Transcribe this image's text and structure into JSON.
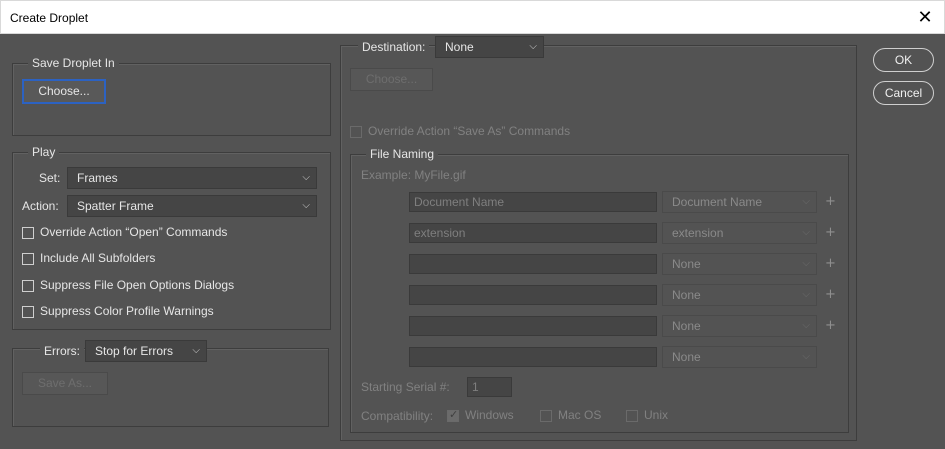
{
  "window": {
    "title": "Create Droplet",
    "close_glyph": "✕"
  },
  "save_in": {
    "legend": "Save Droplet In",
    "choose_label": "Choose..."
  },
  "play": {
    "legend": "Play",
    "set_label": "Set:",
    "set_value": "Frames",
    "action_label": "Action:",
    "action_value": "Spatter Frame",
    "options": [
      "Override Action “Open” Commands",
      "Include All Subfolders",
      "Suppress File Open Options Dialogs",
      "Suppress Color Profile Warnings"
    ]
  },
  "errors": {
    "label": "Errors:",
    "value": "Stop for Errors",
    "save_as_label": "Save As..."
  },
  "destination": {
    "label": "Destination:",
    "value": "None",
    "choose_label": "Choose...",
    "override_label": "Override Action “Save As” Commands"
  },
  "file_naming": {
    "legend": "File Naming",
    "example": "Example: MyFile.gif",
    "rows": [
      {
        "input": "Document Name",
        "select": "Document Name",
        "plus": "+"
      },
      {
        "input": "extension",
        "select": "extension",
        "plus": "+"
      },
      {
        "input": "",
        "select": "None",
        "plus": "+"
      },
      {
        "input": "",
        "select": "None",
        "plus": "+"
      },
      {
        "input": "",
        "select": "None",
        "plus": "+"
      },
      {
        "input": "",
        "select": "None",
        "plus": ""
      }
    ],
    "serial_label": "Starting Serial #:",
    "serial_value": "1",
    "compat_label": "Compatibility:",
    "compat": [
      "Windows",
      "Mac OS",
      "Unix"
    ],
    "compat_checked": [
      true,
      false,
      false
    ]
  },
  "buttons": {
    "ok": "OK",
    "cancel": "Cancel"
  },
  "icons": {
    "chevron": "⌵"
  }
}
